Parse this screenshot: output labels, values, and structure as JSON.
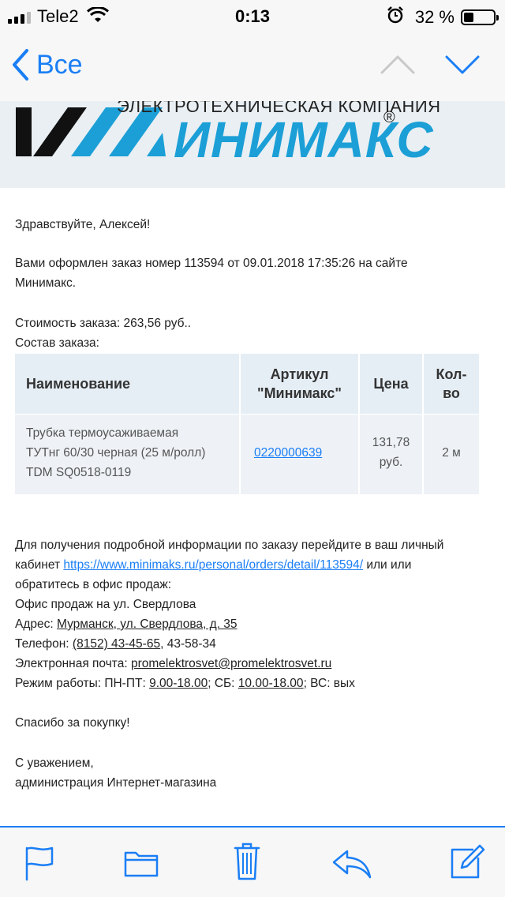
{
  "status_bar": {
    "carrier": "Tele2",
    "time": "0:13",
    "battery_percent": "32 %",
    "battery_level": 0.32
  },
  "nav": {
    "back_label": "Все"
  },
  "banner": {
    "company_subtitle": "ЭЛЕКТРОТЕХНИЧЕСКАЯ КОМПАНИЯ",
    "brand_name": "ИНИМАКС",
    "registered_mark": "®"
  },
  "email": {
    "greeting": "Здравствуйте, Алексей!",
    "order_line": "Вами оформлен заказ номер 113594 от 09.01.2018 17:35:26 на сайте Минимакс.",
    "cost": "Стоимость заказа: 263,56 руб..",
    "composition": "Состав заказа:",
    "table": {
      "headers": {
        "name": "Наименование",
        "article_line1": "Артикул",
        "article_line2": "\"Минимакс\"",
        "price": "Цена",
        "qty_line1": "Кол-",
        "qty_line2": "во"
      },
      "rows": [
        {
          "name_line1": "Трубка термоусаживаемая",
          "name_line2": "ТУТнг 60/30 черная (25 м/ролл)",
          "name_line3": "TDM SQ0518-0119",
          "article": "0220000639",
          "price_line1": "131,78",
          "price_line2": "руб.",
          "qty": "2 м"
        }
      ]
    },
    "info": {
      "line1": "Для получения подробной информации по заказу перейдите в ваш личный",
      "line2_prefix": "кабинет",
      "line2_link": "https://www.minimaks.ru/personal/orders/detail/113594/",
      "line2_suffix": "или или",
      "line3": "обратитесь в офис продаж:",
      "line4": "Офис продаж на ул. Свердлова",
      "address_label": "Адрес:",
      "address_value": "Мурманск, ул. Свердлова, д. 35",
      "phone_label": "Телефон:",
      "phone_value1": "(8152) 43-45-65",
      "phone_value2": ", 43-58-34",
      "email_label": "Электронная почта:",
      "email_value": "promelektrosvet@promelektrosvet.ru",
      "hours_prefix": "Режим работы: ПН-ПТ:",
      "hours_weekday": "9.00-18.00",
      "hours_sat_label": "; СБ:",
      "hours_sat": "10.00-18.00",
      "hours_sun": "; ВС: вых"
    },
    "thanks": "Спасибо за покупку!",
    "regards_line1": "С уважением,",
    "regards_line2": "администрация Интернет-магазина"
  },
  "toolbar": {
    "icons": [
      "flag-icon",
      "folder-icon",
      "trash-icon",
      "reply-icon",
      "compose-icon"
    ]
  },
  "colors": {
    "accent": "#1a7ef5",
    "brand": "#1b9fd6",
    "table_header_bg": "#e6eef5"
  }
}
